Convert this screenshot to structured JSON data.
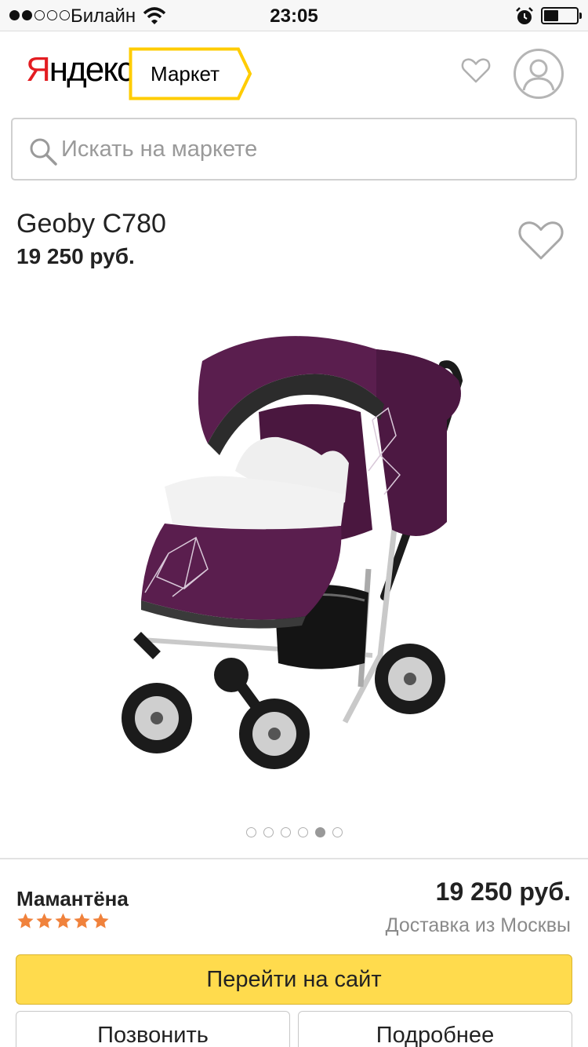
{
  "status_bar": {
    "carrier": "Билайн",
    "time": "23:05",
    "signal_bars_filled": 2,
    "signal_bars_total": 5,
    "battery_level": 0.45,
    "icons": [
      "wifi-icon",
      "alarm-icon",
      "battery-icon"
    ]
  },
  "header": {
    "logo_first_letter": "Я",
    "logo_rest": "ндекс",
    "tab_label": "Маркет",
    "icons": [
      "heart-outline-icon",
      "user-avatar-icon"
    ]
  },
  "search": {
    "placeholder": "Искать на маркете",
    "value": ""
  },
  "product": {
    "title": "Geoby C780",
    "price": "19 250 руб.",
    "image_subject": "purple baby stroller",
    "gallery_count": 6,
    "gallery_active_index": 4
  },
  "offer": {
    "shop_name": "Мамантёна",
    "rating": 5,
    "rating_max": 5,
    "price": "19 250 руб.",
    "delivery": "Доставка из Москвы",
    "go_button": "Перейти на сайт",
    "call_button": "Позвонить",
    "more_button": "Подробнее"
  },
  "colors": {
    "brand_red": "#e31c21",
    "accent_yellow": "#ffdb4d",
    "tab_border": "#ffcc00",
    "star": "#f0823c",
    "stroller_purple": "#5a1e4e"
  }
}
